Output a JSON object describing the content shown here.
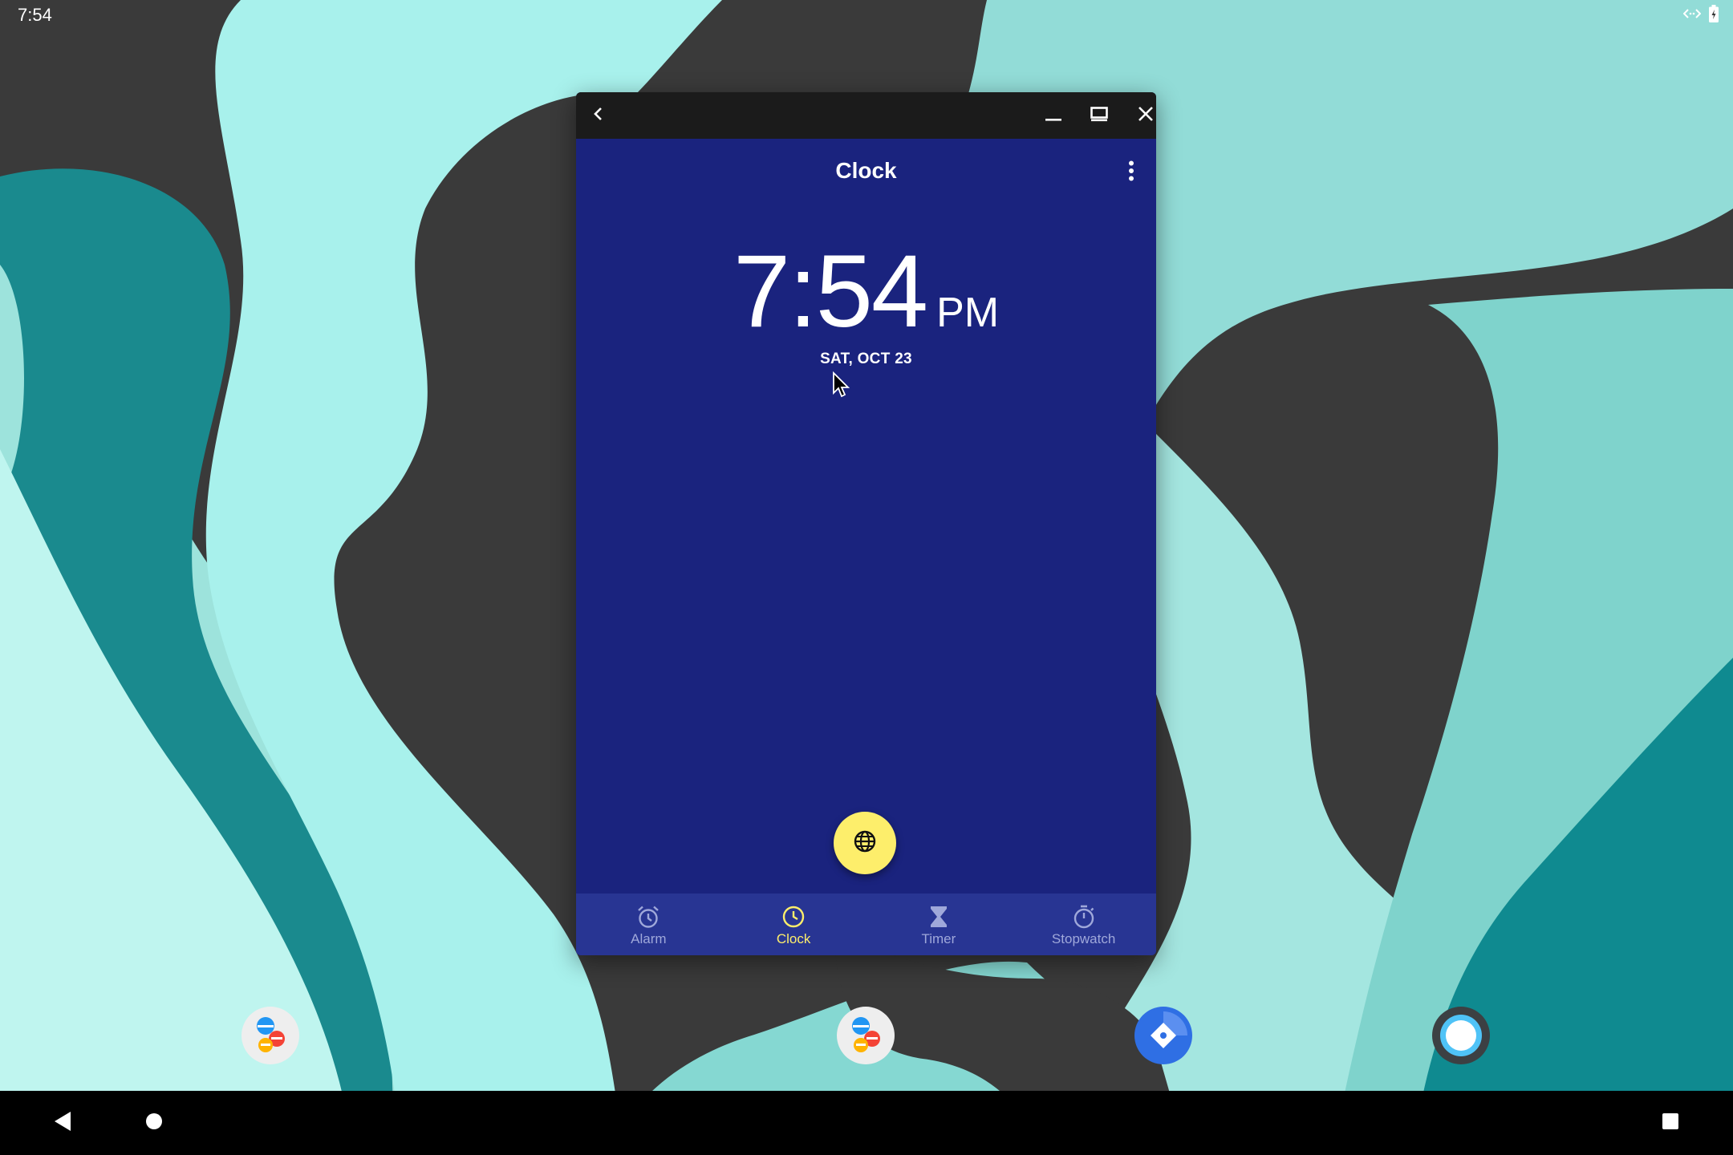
{
  "status_bar": {
    "time": "7:54"
  },
  "window": {
    "title": "Clock",
    "time": "7:54",
    "ampm": "PM",
    "date": "SAT, OCT 23",
    "fab_icon": "globe-icon"
  },
  "bottom_nav": {
    "items": [
      {
        "label": "Alarm",
        "icon": "alarm-icon",
        "active": false
      },
      {
        "label": "Clock",
        "icon": "clock-icon",
        "active": true
      },
      {
        "label": "Timer",
        "icon": "hourglass-icon",
        "active": false
      },
      {
        "label": "Stopwatch",
        "icon": "stopwatch-icon",
        "active": false
      }
    ]
  },
  "colors": {
    "window_bg": "#1a237e",
    "nav_bg": "#283593",
    "accent": "#fdee6b",
    "inactive": "#9fa8da",
    "caption_bar": "#1b1b1b"
  },
  "dock": {
    "apps": [
      {
        "icon": "people-app-icon"
      },
      {
        "icon": "people-app-icon"
      },
      {
        "icon": "navigation-app-icon"
      },
      {
        "icon": "circle-app-icon"
      }
    ]
  }
}
